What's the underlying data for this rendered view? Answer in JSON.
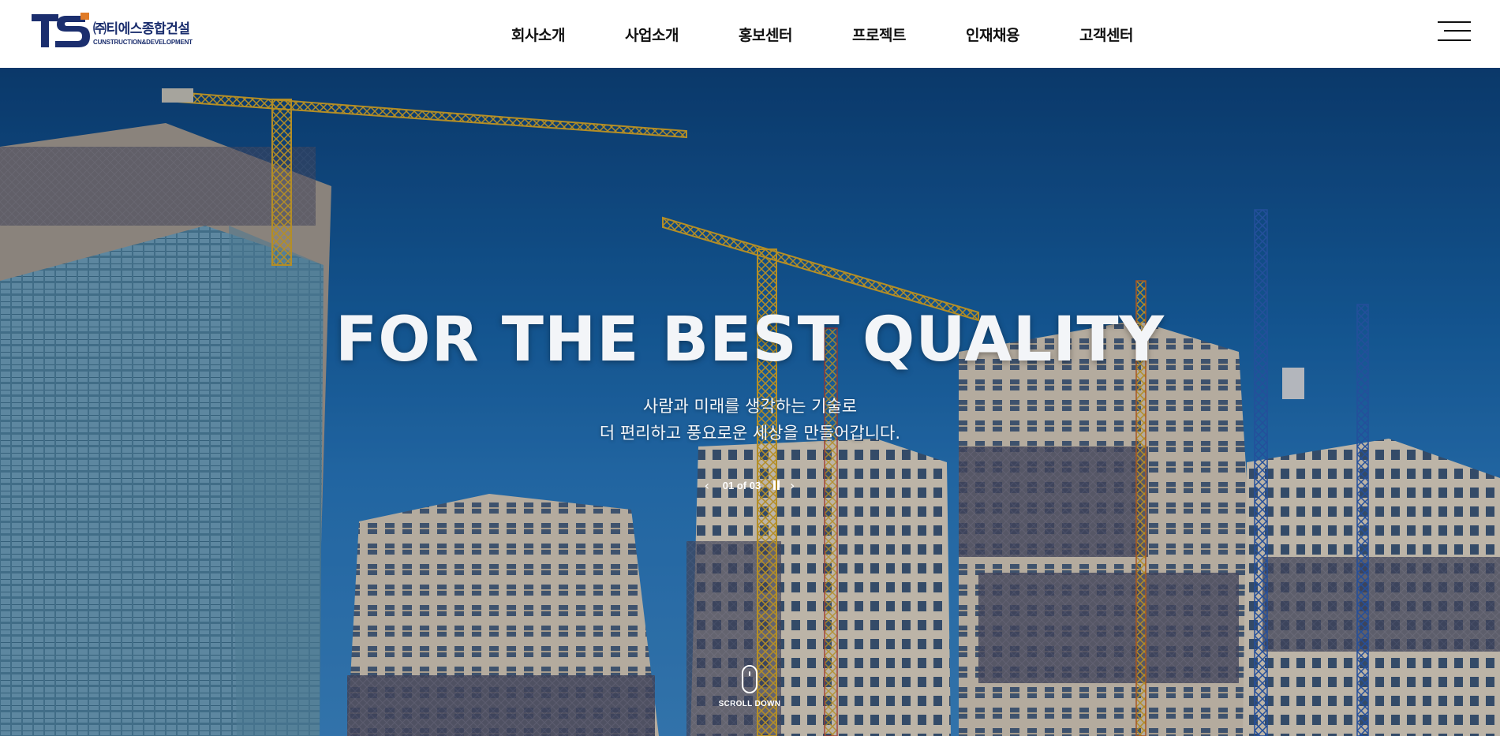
{
  "header": {
    "logo": {
      "mark": "TS",
      "ko": "㈜티에스종합건설",
      "en": "CUNSTRUCTION&DEVELOPMENT"
    },
    "nav": [
      {
        "label": "회사소개"
      },
      {
        "label": "사업소개"
      },
      {
        "label": "홍보센터"
      },
      {
        "label": "프로젝트"
      },
      {
        "label": "인재채용"
      },
      {
        "label": "고객센터"
      }
    ],
    "menu_icon": "hamburger-menu-icon"
  },
  "hero": {
    "title": "FOR THE BEST QUALITY",
    "subtitle_line1": "사람과 미래를 생각하는 기술로",
    "subtitle_line2": "더 편리하고 풍요로운 세상을 만들어갑니다.",
    "slider": {
      "counter": "01 of 03",
      "prev_icon": "chevron-left-icon",
      "pause_icon": "pause-icon",
      "next_icon": "chevron-right-icon"
    },
    "scroll_label": "SCROLL DOWN"
  },
  "colors": {
    "brand_navy": "#1b2e6e",
    "brand_orange": "#e07b27",
    "sky": "#1560a0"
  }
}
